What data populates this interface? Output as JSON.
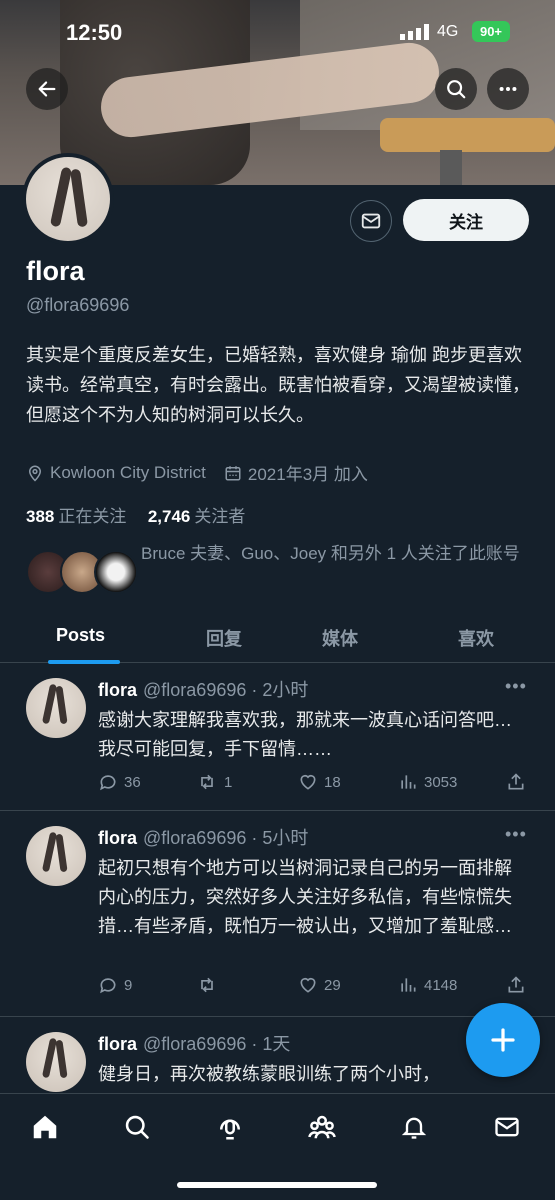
{
  "status_bar": {
    "time": "12:50",
    "network": "4G",
    "battery": "90+"
  },
  "profile": {
    "follow_label": "关注",
    "name": "flora",
    "handle": "@flora69696",
    "bio": "其实是个重度反差女生，已婚轻熟，喜欢健身 瑜伽 跑步更喜欢读书。经常真空，有时会露出。既害怕被看穿，又渴望被读懂，但愿这个不为人知的树洞可以长久。",
    "location": "Kowloon City District",
    "joined": "2021年3月 加入",
    "following_count": "388",
    "following_label": "正在关注",
    "followers_count": "2,746",
    "followers_label": "关注者",
    "followed_by": "Bruce 夫妻、Guo、Joey 和另外 1 人关注了此账号"
  },
  "tabs": [
    {
      "label": "Posts"
    },
    {
      "label": "回复"
    },
    {
      "label": "媒体"
    },
    {
      "label": "喜欢"
    }
  ],
  "posts": [
    {
      "name": "flora",
      "meta": "@flora69696 · 2小时",
      "text": "感谢大家理解我喜欢我，那就来一波真心话问答吧…我尽可能回复，手下留情……",
      "replies": "36",
      "reposts": "1",
      "likes": "18",
      "views": "3053"
    },
    {
      "name": "flora",
      "meta": "@flora69696 · 5小时",
      "text": "起初只想有个地方可以当树洞记录自己的另一面排解内心的压力，突然好多人关注好多私信，有些惊慌失措…有些矛盾，既怕万一被认出，又增加了羞耻感…",
      "replies": "9",
      "reposts": "",
      "likes": "29",
      "views": "4148"
    },
    {
      "name": "flora",
      "meta": "@flora69696 · 1天",
      "text": "健身日，再次被教练蒙眼训练了两个小时，"
    }
  ],
  "more_glyph": "•••",
  "colors": {
    "accent": "#1d9bf0",
    "background": "#15202b",
    "muted": "#8b98a5",
    "battery": "#34c759"
  }
}
